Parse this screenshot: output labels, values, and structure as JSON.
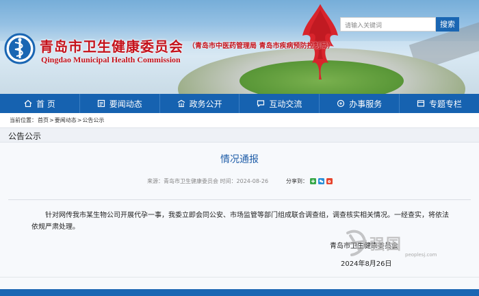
{
  "header": {
    "title": "青岛市卫生健康委员会",
    "subtitle": "（青岛市中医药管理局 青岛市疾病预防控制局）",
    "english_title": "Qingdao Municipal Health Commission",
    "search_placeholder": "请输入关键词",
    "search_button": "搜索"
  },
  "nav": {
    "items": [
      {
        "label": "首 页",
        "icon": "home-icon"
      },
      {
        "label": "要闻动态",
        "icon": "news-icon"
      },
      {
        "label": "政务公开",
        "icon": "building-icon"
      },
      {
        "label": "互动交流",
        "icon": "chat-icon"
      },
      {
        "label": "办事服务",
        "icon": "service-icon"
      },
      {
        "label": "专题专栏",
        "icon": "topic-icon"
      }
    ]
  },
  "breadcrumb": {
    "prefix": "当前位置：",
    "items": [
      "首页",
      "要闻动态",
      "公告公示"
    ],
    "separator": ">"
  },
  "section": {
    "title": "公告公示"
  },
  "article": {
    "title": "情况通报",
    "meta": "来源：青岛市卫生健康委员会  时间：2024-08-26",
    "share_label": "分享到：",
    "body": "针对网传我市某生物公司开展代孕一事，我委立即会同公安、市场监管等部门组成联合调查组，调查核实相关情况。一经查实，将依法依规严肃处理。",
    "signature": "青岛市卫生健康委员会",
    "date": "2024年8月26日"
  },
  "watermark": {
    "text": "强国",
    "url": "peoplesj.com"
  },
  "colors": {
    "brand_red": "#c4121b",
    "nav_blue": "#1662b0",
    "title_blue": "#1f5da8"
  }
}
